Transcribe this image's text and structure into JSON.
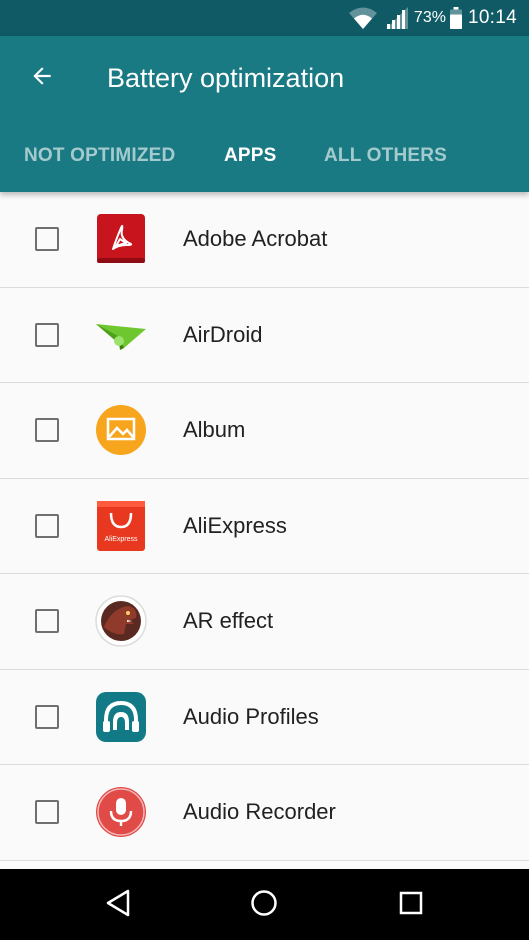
{
  "status": {
    "battery_percent": "73%",
    "time": "10:14"
  },
  "header": {
    "title": "Battery optimization"
  },
  "tabs": [
    {
      "label": "NOT OPTIMIZED",
      "active": false
    },
    {
      "label": "APPS",
      "active": true
    },
    {
      "label": "ALL OTHERS",
      "active": false
    }
  ],
  "apps": [
    {
      "name": "Adobe Acrobat",
      "icon": "adobe-acrobat-icon",
      "checked": false
    },
    {
      "name": "AirDroid",
      "icon": "airdroid-icon",
      "checked": false
    },
    {
      "name": "Album",
      "icon": "album-icon",
      "checked": false
    },
    {
      "name": "AliExpress",
      "icon": "aliexpress-icon",
      "checked": false
    },
    {
      "name": "AR effect",
      "icon": "ar-effect-icon",
      "checked": false
    },
    {
      "name": "Audio Profiles",
      "icon": "audio-profiles-icon",
      "checked": false
    },
    {
      "name": "Audio Recorder",
      "icon": "audio-recorder-icon",
      "checked": false
    }
  ],
  "icon_labels": {
    "aliexpress": "AliExpress"
  },
  "colors": {
    "status_bar": "#0f5a64",
    "app_bar": "#1a7a83",
    "list_background": "#fafafa",
    "divider": "#dcdcdc"
  }
}
